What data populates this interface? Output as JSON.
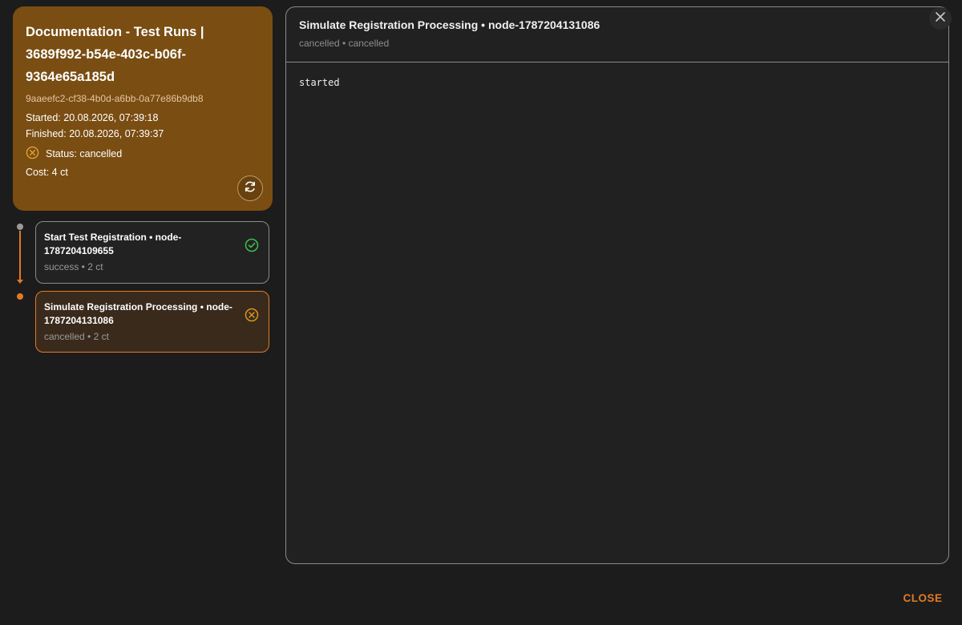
{
  "run": {
    "title": "Documentation - Test Runs | 3689f992-b54e-403c-b06f-9364e65a185d",
    "id": "9aaeefc2-cf38-4b0d-a6bb-0a77e86b9db8",
    "started": "Started: 20.08.2026, 07:39:18",
    "finished": "Finished: 20.08.2026, 07:39:37",
    "status": "Status: cancelled",
    "cost": "Cost: 4 ct"
  },
  "nodes": [
    {
      "title": "Start Test Registration • node-1787204109655",
      "meta": "success • 2 ct",
      "state": "success"
    },
    {
      "title": "Simulate Registration Processing • node-1787204131086",
      "meta": "cancelled • 2 ct",
      "state": "cancelled"
    }
  ],
  "detail": {
    "title": "Simulate Registration Processing • node-1787204131086",
    "subtitle": "cancelled • cancelled",
    "log": "started"
  },
  "footer": {
    "close_label": "CLOSE"
  },
  "colors": {
    "accent": "#e07b25",
    "run_card_bg": "#7a4d12",
    "success": "#3fbf4f",
    "cancelled": "#d9951f"
  },
  "icons": {
    "status": "cancel-circle-icon",
    "refresh": "refresh-icon",
    "success": "check-circle-icon",
    "close": "close-icon"
  }
}
